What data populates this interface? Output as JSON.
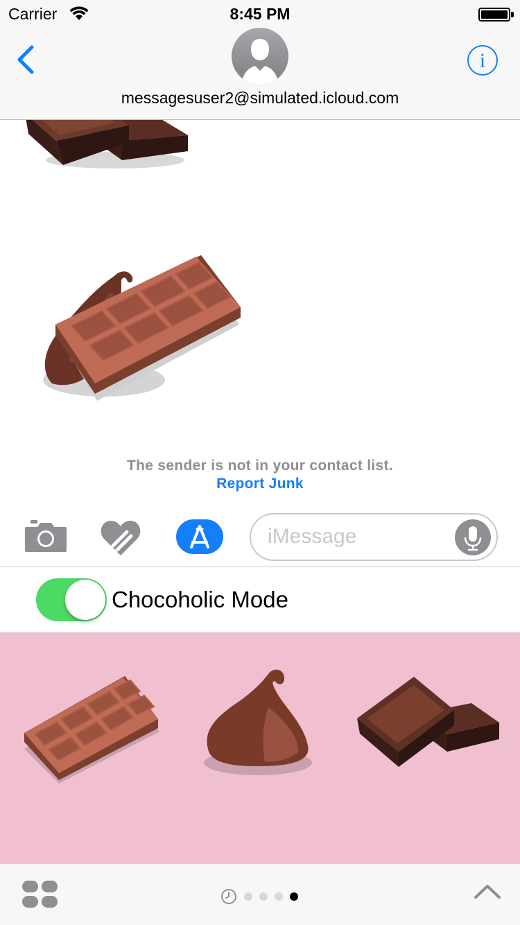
{
  "status_bar": {
    "carrier": "Carrier",
    "time": "8:45 PM"
  },
  "header": {
    "contact": "messagesuser2@simulated.icloud.com",
    "info_glyph": "i",
    "back_icon": "chevron-left-icon",
    "avatar_icon": "person-silhouette-icon"
  },
  "conversation": {
    "messages": [
      {
        "type": "sticker",
        "sticker": "chocolate-pieces",
        "partial": true
      },
      {
        "type": "sticker",
        "sticker": "chocolate-bar-with-drop"
      }
    ],
    "junk_notice": "The sender is not in your contact list.",
    "report_junk": "Report Junk"
  },
  "input_bar": {
    "placeholder": "iMessage",
    "icons": [
      "camera-icon",
      "digital-touch-icon",
      "app-store-icon",
      "microphone-icon"
    ]
  },
  "extension": {
    "toggle_on": true,
    "toggle_label": "Chocoholic Mode",
    "stickers": [
      "chocolate-bar",
      "chocolate-drop",
      "chocolate-pieces"
    ]
  },
  "bottom_bar": {
    "pages_total": 4,
    "current_page": 4,
    "icons": [
      "app-drawer-icon",
      "recents-clock-icon",
      "chevron-up-icon"
    ]
  },
  "colors": {
    "accent": "#147efb",
    "toggle_on": "#4cd964",
    "tray_background": "#f1c0d0",
    "chocolate_light": "#a8604a",
    "chocolate_dark": "#3b2019"
  }
}
